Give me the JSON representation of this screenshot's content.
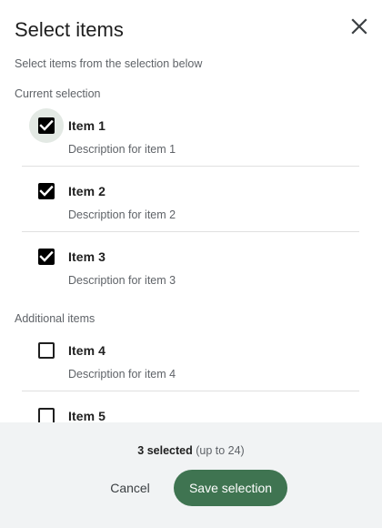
{
  "dialog": {
    "title": "Select items",
    "subtitle": "Select items from the selection below",
    "close_icon": "close-icon"
  },
  "sections": {
    "current_label": "Current selection",
    "additional_label": "Additional items"
  },
  "items": [
    {
      "label": "Item 1",
      "description": "Description for item 1",
      "checked": true
    },
    {
      "label": "Item 2",
      "description": "Description for item 2",
      "checked": true
    },
    {
      "label": "Item 3",
      "description": "Description for item 3",
      "checked": true
    },
    {
      "label": "Item 4",
      "description": "Description for item 4",
      "checked": false
    },
    {
      "label": "Item 5",
      "description": "",
      "checked": false
    }
  ],
  "footer": {
    "selected_count": "3 selected",
    "limit": "(up to 24)",
    "cancel_label": "Cancel",
    "save_label": "Save selection"
  },
  "colors": {
    "primary_button": "#3f7451",
    "footer_background": "#f1f3f4",
    "checkbox_checked": "#000000"
  }
}
